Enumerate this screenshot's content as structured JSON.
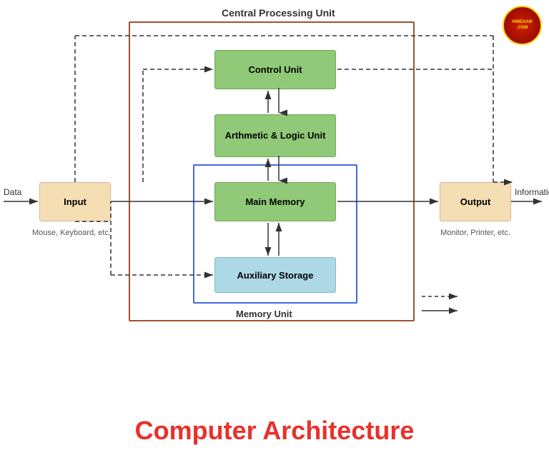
{
  "diagram": {
    "cpu_label": "Central Processing Unit",
    "memory_unit_label": "Memory Unit",
    "control_unit_label": "Control Unit",
    "alu_label": "Arthmetic & Logic Unit",
    "main_memory_label": "Main Memory",
    "aux_storage_label": "Auxiliary Storage",
    "input_label": "Input",
    "output_label": "Output",
    "input_sublabel": "Mouse, Keyboard, etc.",
    "output_sublabel": "Monitor, Printer, etc.",
    "data_label": "Data",
    "info_label": "Information"
  },
  "title": "Computer Architecture",
  "logo_text": "HIMEXAM.COM",
  "legend": {
    "dashed": "dashed arrow",
    "solid": "solid arrow"
  }
}
